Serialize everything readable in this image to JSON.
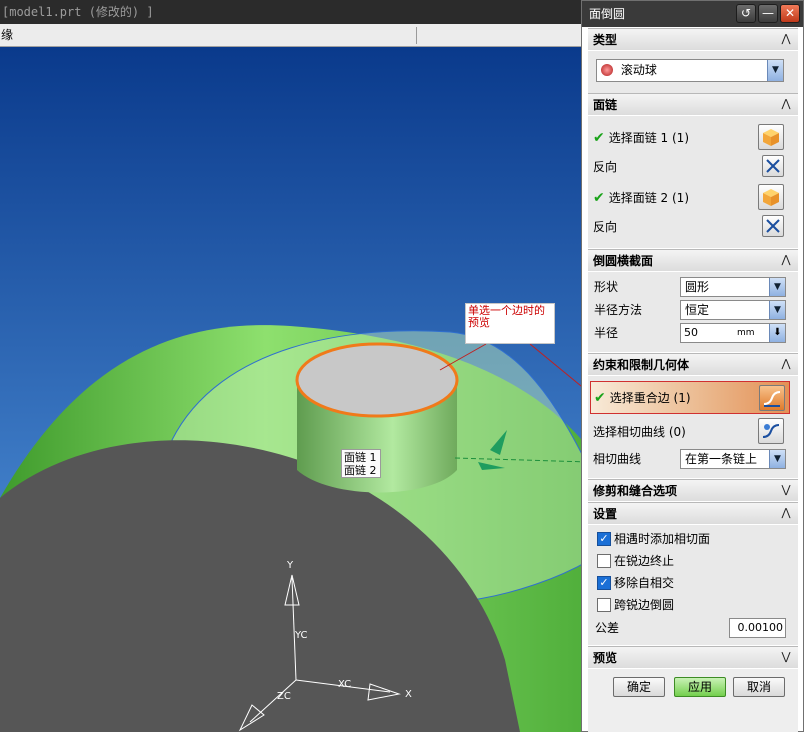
{
  "window": {
    "title": "[model1.prt (修改的) ]",
    "edge_label": "缘"
  },
  "viewport": {
    "callout_text": "单选一个边时的预览",
    "chain_labels": [
      "面链 1",
      "面链 2"
    ],
    "axes": {
      "y": "Y",
      "yc": "YC",
      "x": "X",
      "xc": "XC",
      "zc": "ZC"
    }
  },
  "dialog": {
    "title": "面倒圆",
    "title_buttons": {
      "reset": "↺",
      "minimize": "—",
      "close": "✕"
    },
    "type_group": {
      "header": "类型",
      "selected": "滚动球"
    },
    "face_chain_group": {
      "header": "面链",
      "select_chain_1": "选择面链 1 (1)",
      "reverse_1": "反向",
      "select_chain_2": "选择面链 2 (1)",
      "reverse_2": "反向"
    },
    "cross_section_group": {
      "header": "倒圆横截面",
      "shape_label": "形状",
      "shape_value": "圆形",
      "radius_method_label": "半径方法",
      "radius_method_value": "恒定",
      "radius_label": "半径",
      "radius_value": "50",
      "radius_unit": "mm"
    },
    "constraint_group": {
      "header": "约束和限制几何体",
      "select_coincident_edge": "选择重合边 (1)",
      "select_tangent_curve": "选择相切曲线 (0)",
      "tangent_curve_label": "相切曲线",
      "tangent_curve_value": "在第一条链上"
    },
    "trim_group": {
      "header": "修剪和缝合选项"
    },
    "settings_group": {
      "header": "设置",
      "options": [
        {
          "label": "相遇时添加相切面",
          "checked": true
        },
        {
          "label": "在锐边终止",
          "checked": false
        },
        {
          "label": "移除自相交",
          "checked": true
        },
        {
          "label": "跨锐边倒圆",
          "checked": false
        }
      ],
      "tolerance_label": "公差",
      "tolerance_value": "0.00100"
    },
    "preview_group": {
      "header": "预览"
    },
    "buttons": {
      "ok": "确定",
      "apply": "应用",
      "cancel": "取消"
    }
  }
}
